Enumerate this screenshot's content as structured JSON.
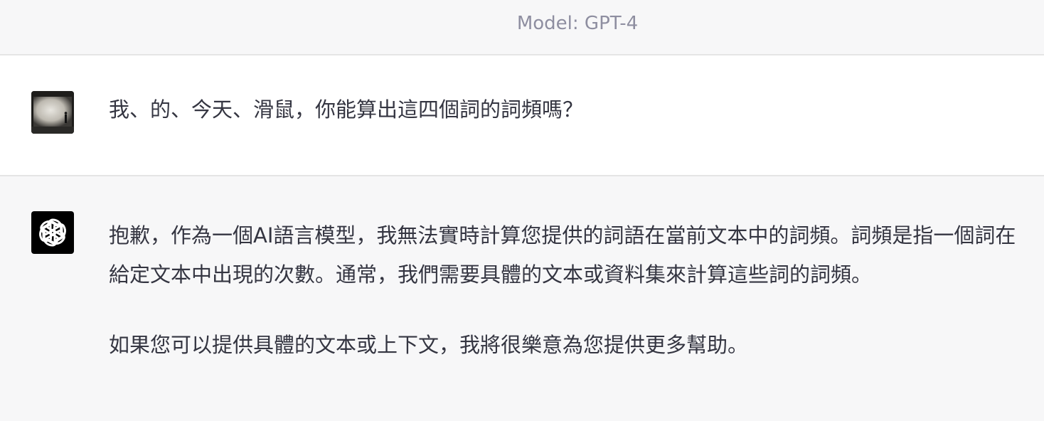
{
  "header": {
    "model_label": "Model: GPT-4"
  },
  "user_message": {
    "text": "我、的、今天、滑鼠，你能算出這四個詞的詞頻嗎？",
    "avatar": "user-photo-avatar"
  },
  "assistant_message": {
    "icon": "openai-logo-icon",
    "paragraphs": [
      "抱歉，作為一個AI語言模型，我無法實時計算您提供的詞語在當前文本中的詞頻。詞頻是指一個詞在給定文本中出現的次數。通常，我們需要具體的文本或資料集來計算這些詞的詞頻。",
      "如果您可以提供具體的文本或上下文，我將很樂意為您提供更多幫助。"
    ]
  },
  "colors": {
    "header_bg": "#f7f7f8",
    "user_bg": "#ffffff",
    "assistant_bg": "#f7f7f8",
    "divider": "#e5e5e5",
    "text": "#343541",
    "muted": "#8e8ea0",
    "icon_bg": "#000000"
  }
}
